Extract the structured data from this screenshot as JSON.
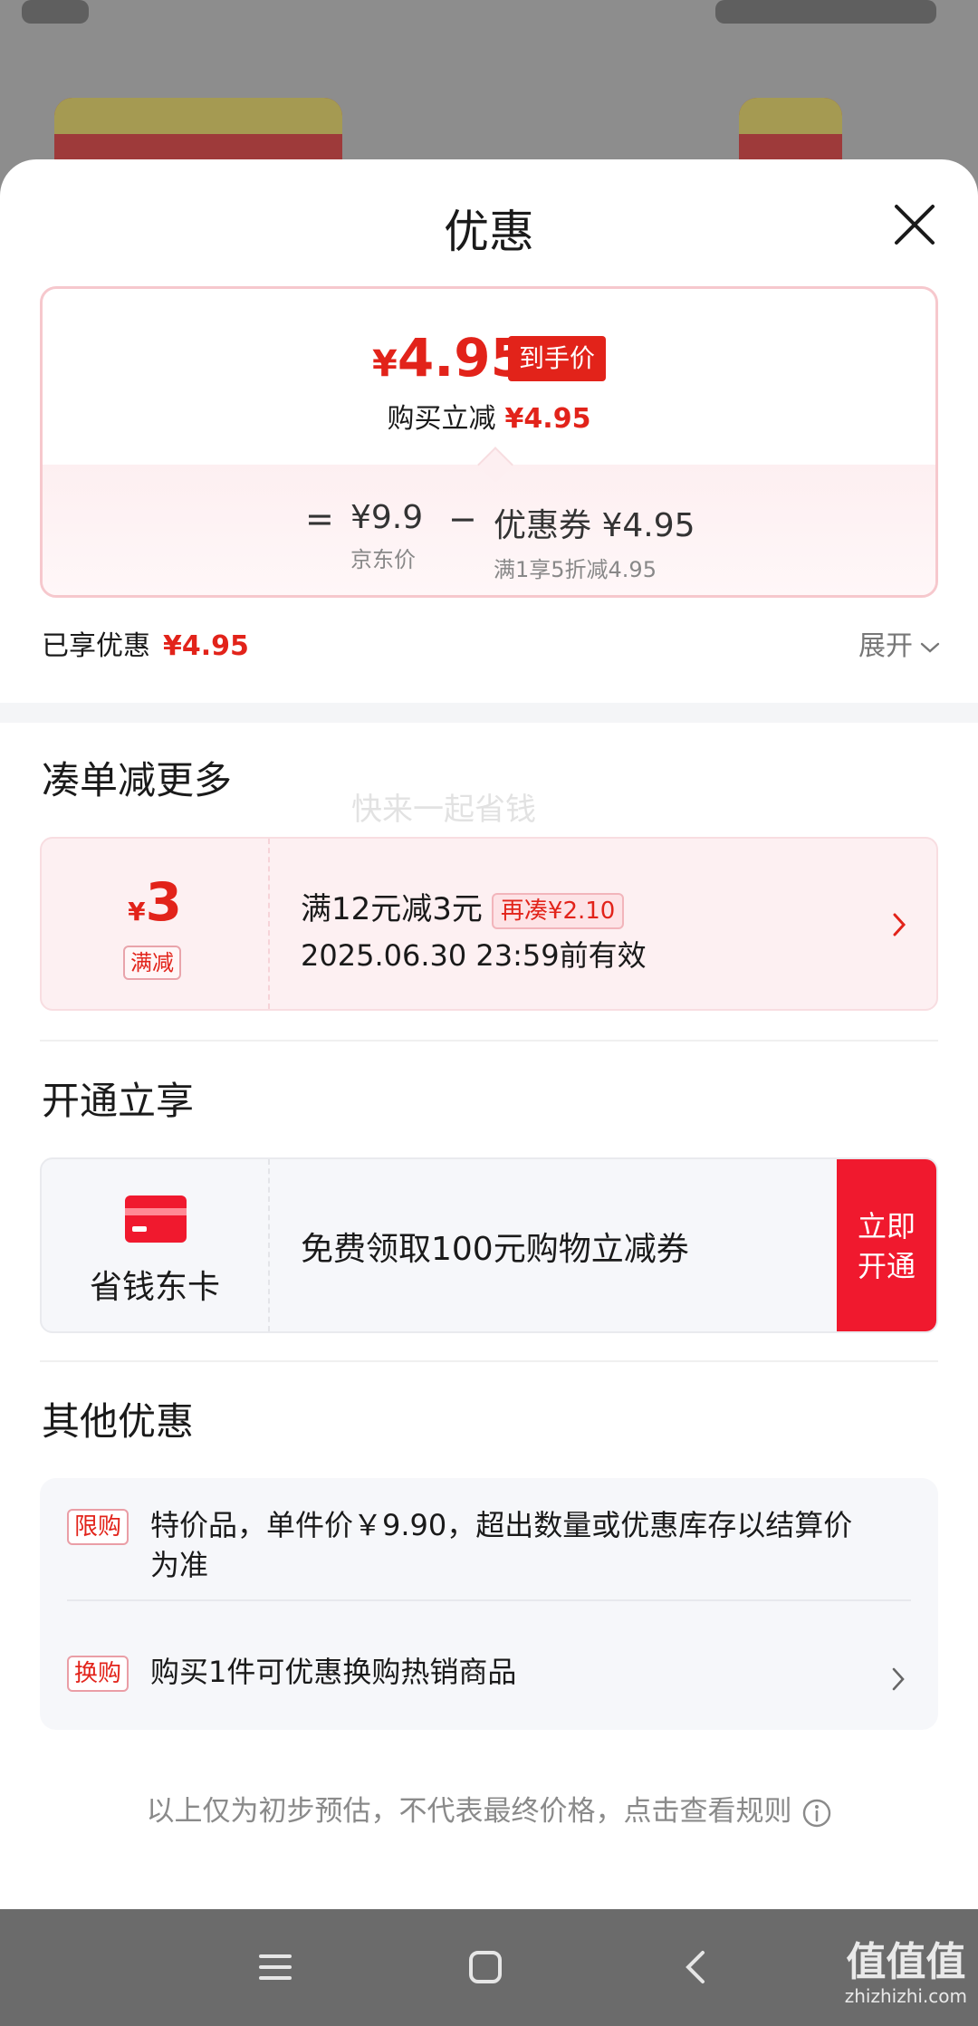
{
  "sheet": {
    "title": "优惠",
    "close_icon": "close-icon"
  },
  "price_card": {
    "final_price_symbol": "¥",
    "final_price": "4.95",
    "final_tag": "到手价",
    "reduce_label": "购买立减",
    "reduce_amount": "¥4.95",
    "equals": "=",
    "minus": "−",
    "jd_price": "¥9.9",
    "jd_price_label": "京东价",
    "coupon_value": "优惠券 ¥4.95",
    "coupon_desc": "满1享5折减4.95"
  },
  "enjoyed": {
    "label": "已享优惠",
    "amount": "¥4.95",
    "expand_label": "展开"
  },
  "combine_section": {
    "title": "凑单减更多",
    "coupon": {
      "symbol": "¥",
      "amount": "3",
      "tag": "满减",
      "rule": "满12元减3元",
      "more_tag": "再凑¥2.10",
      "valid": "2025.06.30 23:59前有效"
    }
  },
  "open_section": {
    "title": "开通立享",
    "card_name": "省钱东卡",
    "offer": "免费领取100元购物立减券",
    "button_line1": "立即",
    "button_line2": "开通"
  },
  "other_section": {
    "title": "其他优惠",
    "items": [
      {
        "tag": "限购",
        "text": "特价品，单件价￥9.90，超出数量或优惠库存以结算价为准"
      },
      {
        "tag": "换购",
        "text": "购买1件可优惠换购热销商品"
      }
    ]
  },
  "disclaimer": "以上仅为初步预估，不代表最终价格，点击查看规则",
  "faint_watermark": "快来一起省钱",
  "navbar": {
    "menu_icon": "menu-icon",
    "home_icon": "home-icon",
    "back_icon": "back-icon"
  },
  "watermark": {
    "main": "值值值",
    "sub": "zhizhizhi.com"
  },
  "colors": {
    "accent_red": "#e2231a",
    "button_red": "#f0192e"
  }
}
